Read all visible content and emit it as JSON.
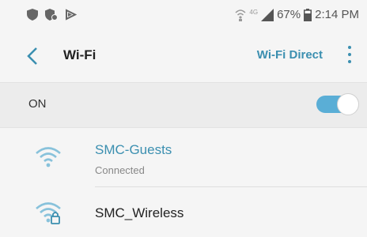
{
  "status_bar": {
    "battery": "67%",
    "time": "2:14 PM",
    "left_icons": [
      "shield-icon",
      "shield-check-icon",
      "cast-icon"
    ],
    "right_icons": [
      "wifi-call-icon",
      "lte-icon",
      "signal-icon",
      "battery-icon"
    ],
    "network_type": "4G"
  },
  "header": {
    "title": "Wi-Fi",
    "action_label": "Wi-Fi Direct",
    "back_icon": "chevron-left-icon",
    "menu_icon": "more-vert-icon"
  },
  "toggle_row": {
    "label": "ON",
    "enabled": true
  },
  "networks": [
    {
      "name": "SMC-Guests",
      "status": "Connected",
      "secured": false,
      "color": "#3b8fb0"
    },
    {
      "name": "SMC_Wireless",
      "status": "",
      "secured": true,
      "color": "#222222"
    }
  ],
  "colors": {
    "accent": "#3b8fb0",
    "toggle_on": "#5aaed6",
    "background": "#f5f5f5"
  }
}
